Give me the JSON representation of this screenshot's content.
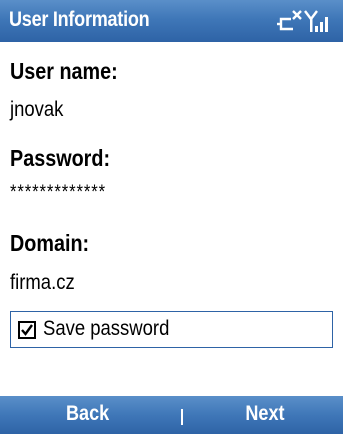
{
  "title_bar": {
    "title": "User Information",
    "icons": [
      "connection-disconnected-icon",
      "signal-strength-icon"
    ]
  },
  "form": {
    "user_name_label": "User name:",
    "user_name_value": "jnovak",
    "password_label": "Password:",
    "password_value": "*************",
    "domain_label": "Domain:",
    "domain_value": "firma.cz",
    "save_password_label": "Save password",
    "save_password_checked": true
  },
  "softkeys": {
    "left": "Back",
    "right": "Next"
  },
  "colors": {
    "bar_blue": "#3f77b8",
    "bar_text": "#ffffff",
    "focus_border": "#2e63a6"
  }
}
